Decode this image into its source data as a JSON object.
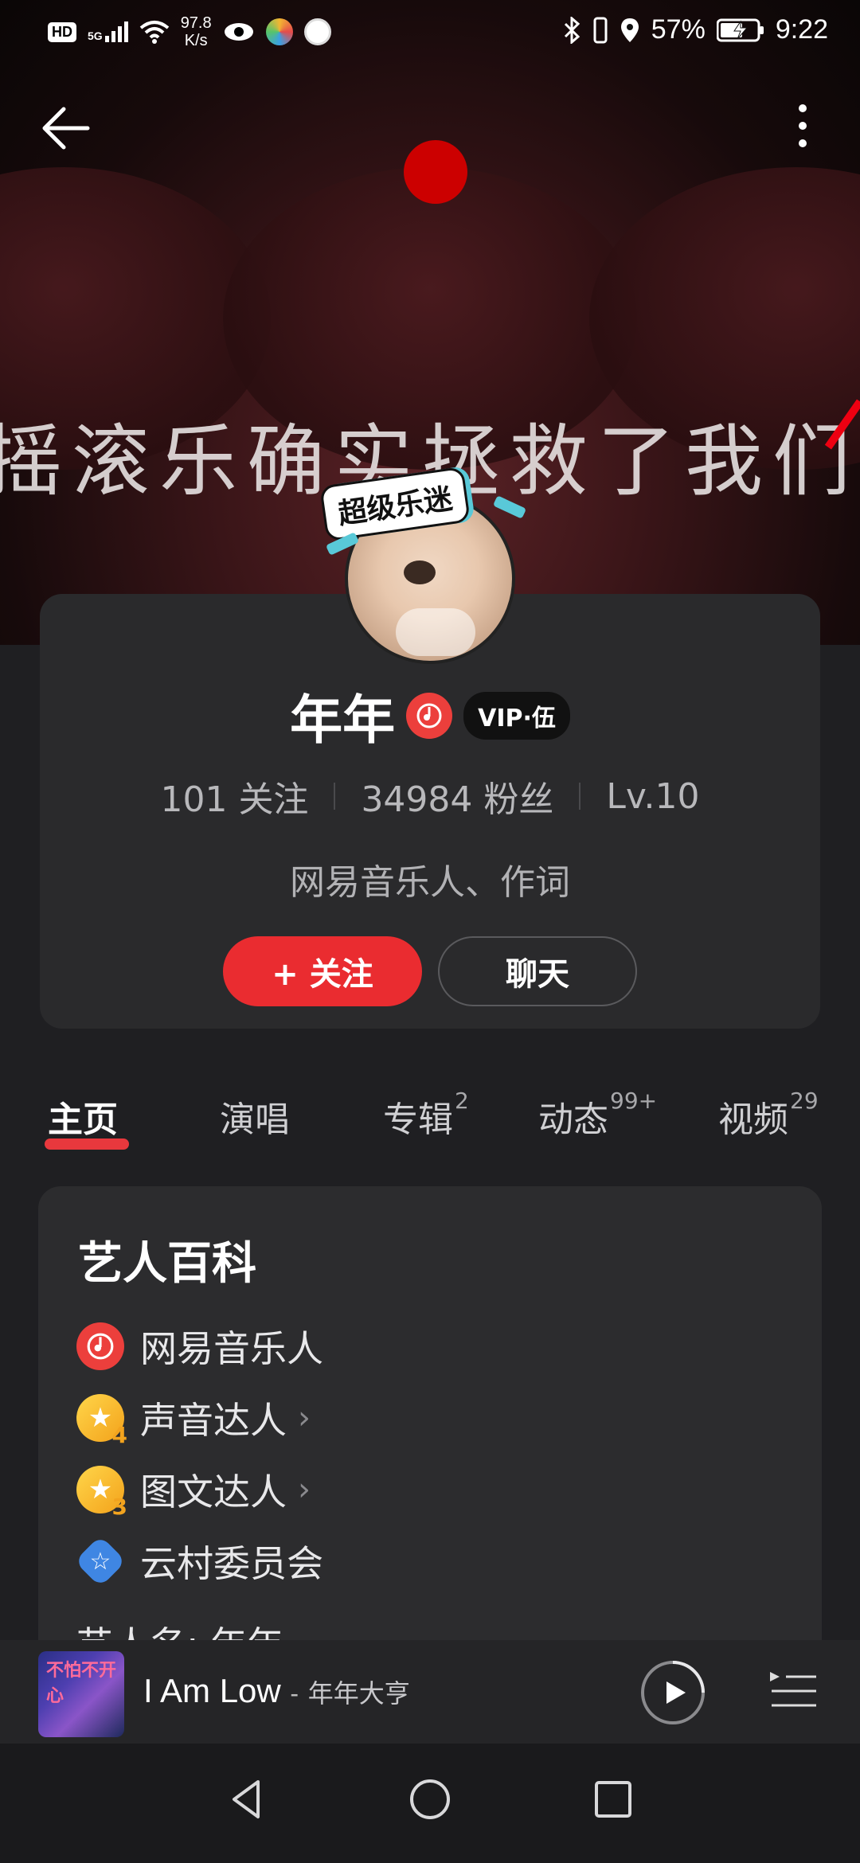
{
  "status_bar": {
    "hd": "HD",
    "signal": "5G",
    "net_speed_value": "97.8",
    "net_speed_unit": "K/s",
    "battery": "57%",
    "time": "9:22"
  },
  "banner": {
    "slogan": "摇滚乐确实拯救了我们"
  },
  "badge": {
    "text": "超级乐迷"
  },
  "profile": {
    "name": "年年",
    "vip_label": "VIP·伍",
    "following_count": "101",
    "following_label": "关注",
    "followers_count": "34984",
    "followers_label": "粉丝",
    "level": "Lv.10",
    "description": "网易音乐人、作词",
    "follow_button": "+ 关注",
    "chat_button": "聊天"
  },
  "tabs": [
    {
      "label": "主页",
      "count": ""
    },
    {
      "label": "演唱",
      "count": ""
    },
    {
      "label": "专辑",
      "count": "2"
    },
    {
      "label": "动态",
      "count": "99+"
    },
    {
      "label": "视频",
      "count": "29"
    }
  ],
  "encyclopedia": {
    "title": "艺人百科",
    "items": [
      {
        "label": "网易音乐人",
        "icon": "netease-music-icon"
      },
      {
        "label": "声音达人",
        "icon": "star-level-4-icon",
        "level": "4"
      },
      {
        "label": "图文达人",
        "icon": "star-level-3-icon",
        "level": "3"
      },
      {
        "label": "云村委员会",
        "icon": "committee-star-icon"
      }
    ],
    "partial_line": "艺人名: 年年"
  },
  "player": {
    "song": "I Am Low",
    "separator": "-",
    "artist": "年年大亨",
    "cover_text": "不怕不开心"
  },
  "colors": {
    "accent_red": "#ea2c30",
    "card_bg": "#2a2a2c",
    "page_bg": "#1f1f22"
  }
}
